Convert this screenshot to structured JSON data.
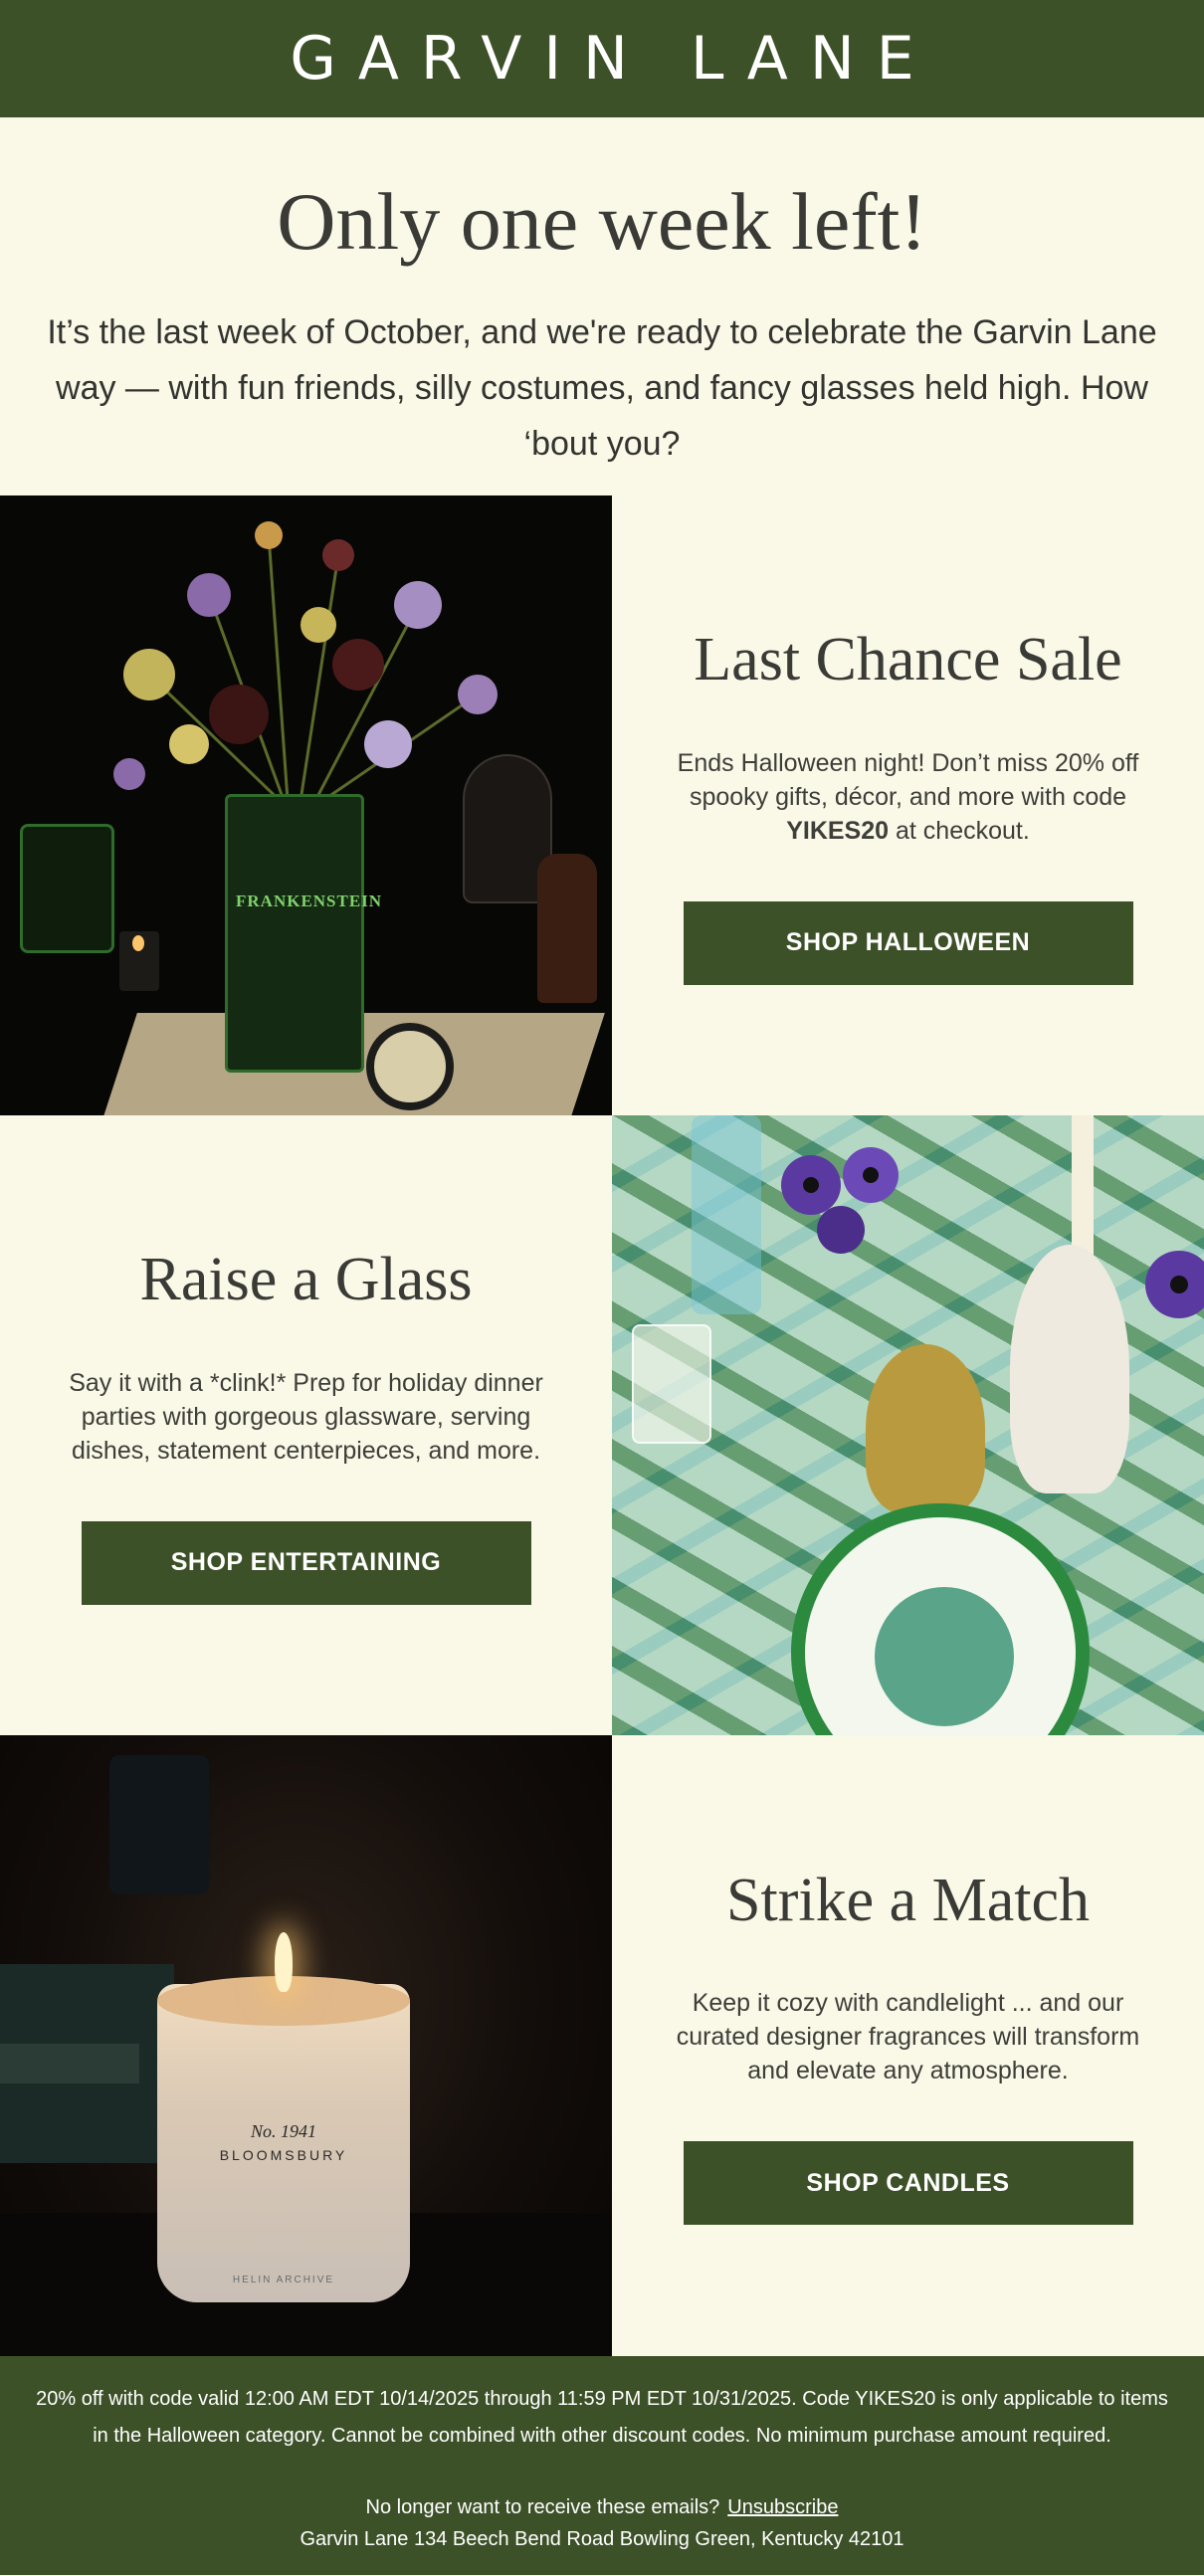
{
  "brand": {
    "logo": "GARVIN LANE"
  },
  "intro": {
    "headline": "Only one week left!",
    "body": "It’s the last week of October, and we're ready to celebrate the Garvin Lane way — with fun friends, silly costumes, and fancy glasses held high. How ‘bout you?"
  },
  "sections": [
    {
      "title": "Last Chance Sale",
      "body_pre": "Ends Halloween night! Don’t miss 20% off spooky gifts, décor, and more with code ",
      "body_code": "YIKES20",
      "body_post": " at checkout.",
      "cta": "SHOP HALLOWEEN",
      "image_text": "FRANKENSTEIN"
    },
    {
      "title": "Raise a Glass",
      "body": "Say it with a *clink!* Prep for holiday dinner parties with gorgeous glassware, serving dishes, statement centerpieces, and more.",
      "cta": "SHOP ENTERTAINING"
    },
    {
      "title": "Strike a Match",
      "body": "Keep it cozy with candlelight ... and our curated designer fragrances will transform and elevate any atmosphere.",
      "cta": "SHOP CANDLES",
      "image_text": {
        "line1": "No. 1941",
        "line2": "BLOOMSBURY",
        "line3": "HELIN ARCHIVE"
      }
    }
  ],
  "footer": {
    "terms": "20% off with code valid 12:00 AM EDT 10/14/2025 through 11:59 PM EDT 10/31/2025. Code YIKES20 is only applicable to items in the Halloween category. Cannot be combined with other discount codes. No minimum purchase amount required.",
    "unsubscribe_prompt": "No longer want to receive these emails?",
    "unsubscribe_link": "Unsubscribe",
    "address": "Garvin Lane 134 Beech Bend Road Bowling Green, Kentucky 42101"
  },
  "colors": {
    "brand_green": "#3d5128",
    "cream": "#faf8e6",
    "text": "#3a3a36"
  }
}
